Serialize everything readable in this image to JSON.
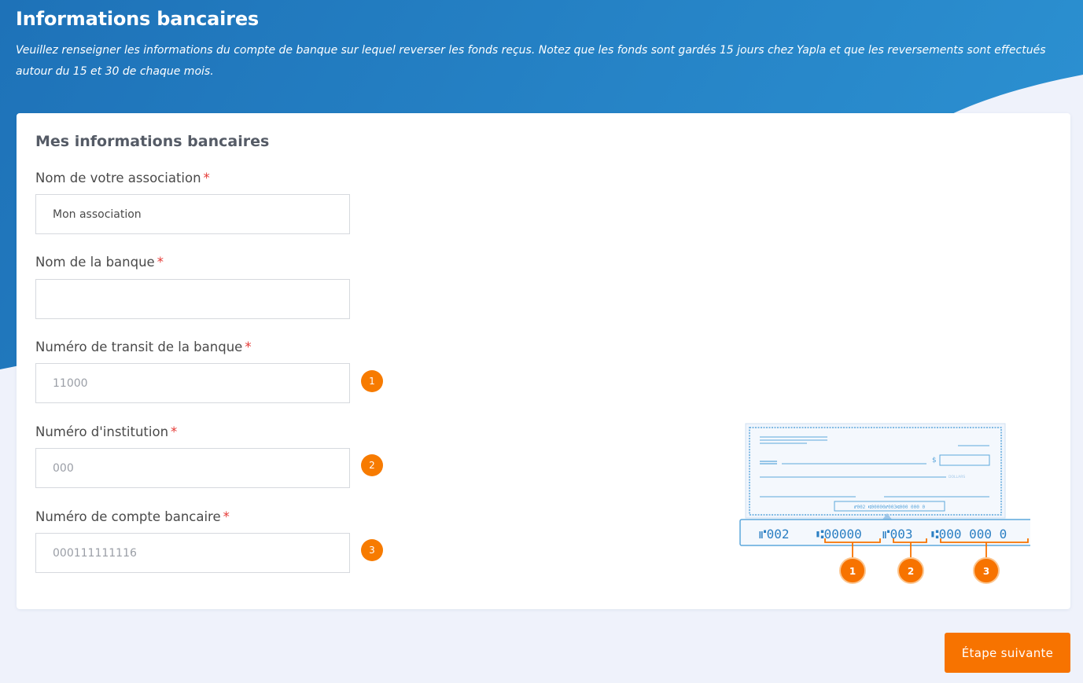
{
  "header": {
    "title": "Informations bancaires",
    "description": "Veuillez renseigner les informations du compte de banque sur lequel reverser les fonds reçus. Notez que les fonds sont gardés 15 jours chez Yapla et que les reversements sont effectués autour du 15 et 30 de chaque mois."
  },
  "card": {
    "title": "Mes informations bancaires",
    "fields": [
      {
        "label": "Nom de votre association",
        "required_mark": "*",
        "value": "Mon association",
        "placeholder": ""
      },
      {
        "label": "Nom de la banque",
        "required_mark": "*",
        "value": "",
        "placeholder": ""
      },
      {
        "label": "Numéro de transit de la banque",
        "required_mark": "*",
        "value": "",
        "placeholder": "11000",
        "badge": "1"
      },
      {
        "label": "Numéro d'institution",
        "required_mark": "*",
        "value": "",
        "placeholder": "000",
        "badge": "2"
      },
      {
        "label": "Numéro de compte bancaire",
        "required_mark": "*",
        "value": "",
        "placeholder": "000111111116",
        "badge": "3"
      }
    ]
  },
  "cheque": {
    "dollar_sign": "$",
    "dollars_label": "DOLLARS",
    "micr_small": "⑈002 ⑆00000⑈003⑆000 000 0",
    "micr": {
      "part0": "⑈002",
      "transit": "⑆00000",
      "institution": "⑈003",
      "account": "⑆000 000 0"
    },
    "badges": [
      "1",
      "2",
      "3"
    ]
  },
  "colors": {
    "accent": "#f77300",
    "header_blue": "#2180c2",
    "cheque_blue": "#5da7dc"
  },
  "actions": {
    "next_label": "Étape suivante"
  }
}
